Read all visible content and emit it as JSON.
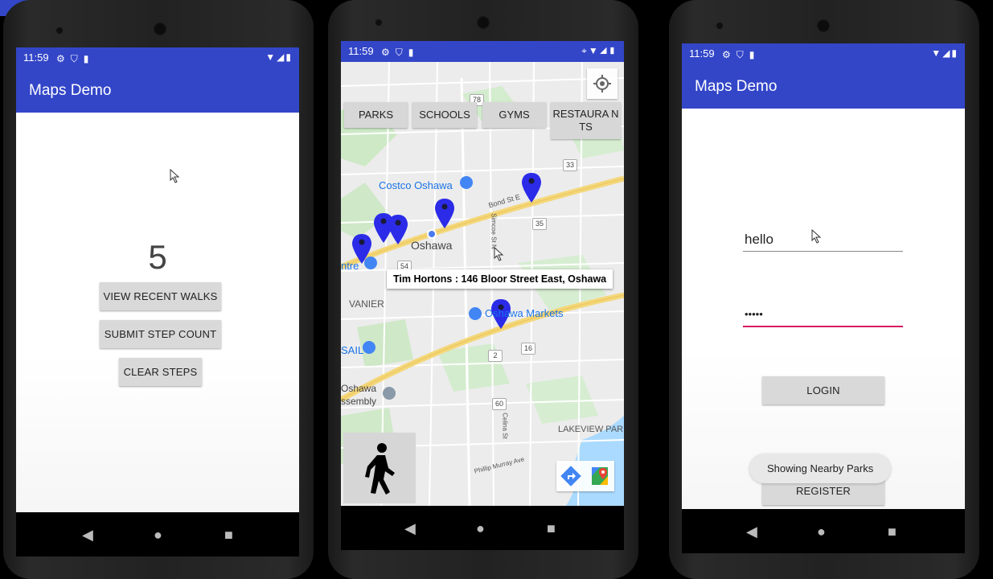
{
  "phone1": {
    "status_time": "11:59",
    "app_title": "Maps Demo",
    "step_count": "5",
    "buttons": {
      "view_recent_walks": "VIEW RECENT WALKS",
      "submit_step_count": "SUBMIT STEP COUNT",
      "clear_steps": "CLEAR STEPS"
    }
  },
  "phone2": {
    "status_time": "11:59",
    "filters": {
      "parks": "PARKS",
      "schools": "SCHOOLS",
      "gyms": "GYMS",
      "restaurants": "RESTAURA NTS"
    },
    "info_window": "Tim Hortons : 146 Bloor Street East, Oshawa",
    "map_labels": {
      "costco": "Costco Oshawa",
      "oshawa": "Oshawa",
      "centre": "ntre",
      "vanier": "VANIER",
      "sail": "SAIL",
      "markets": "Oshawa Markets",
      "assembly_1": "Oshawa",
      "assembly_2": "ssembly",
      "lakeview": "LAKEVIEW PAR",
      "bond": "Bond St E",
      "simcoe": "Simcoe St N",
      "celina": "Celina St",
      "phillip": "Phillip Murray Ave"
    },
    "route_shields": [
      "78",
      "33",
      "35",
      "54",
      "2",
      "16",
      "60"
    ]
  },
  "phone3": {
    "status_time": "11:59",
    "app_title": "Maps Demo",
    "username_value": "hello",
    "password_value": "•••••",
    "login_label": "LOGIN",
    "register_label": "REGISTER",
    "toast": "Showing Nearby Parks"
  },
  "colors": {
    "app_bar": "#3346c8",
    "marker": "#2b2be8",
    "password_underline": "#d81b60"
  }
}
